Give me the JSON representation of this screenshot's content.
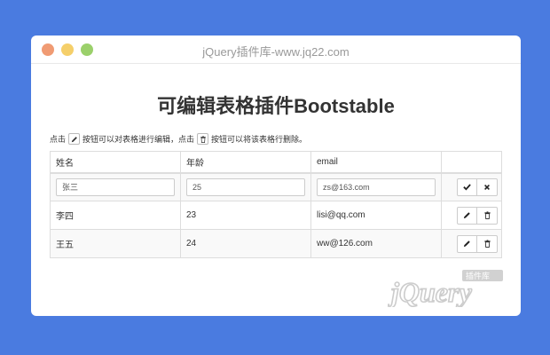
{
  "window": {
    "title": "jQuery插件库-www.jq22.com"
  },
  "heading": "可编辑表格插件Bootstable",
  "hint": {
    "part1": "点击",
    "part2": "按钮可以对表格进行编辑，点击",
    "part3": "按钮可以将该表格行删除。"
  },
  "table": {
    "headers": [
      "姓名",
      "年龄",
      "email",
      ""
    ],
    "editing_row": {
      "name": "张三",
      "age": "25",
      "email": "zs@163.com"
    },
    "rows": [
      {
        "name": "李四",
        "age": "23",
        "email": "lisi@qq.com"
      },
      {
        "name": "王五",
        "age": "24",
        "email": "ww@126.com"
      }
    ]
  },
  "icons": {
    "edit": "pencil-icon",
    "delete": "trash-icon",
    "accept": "check-icon",
    "cancel": "close-icon"
  },
  "logo": {
    "main": "jQuery",
    "badge": "插件库"
  },
  "colors": {
    "background": "#4a7be0",
    "window": "#ffffff",
    "heading": "#333333"
  }
}
